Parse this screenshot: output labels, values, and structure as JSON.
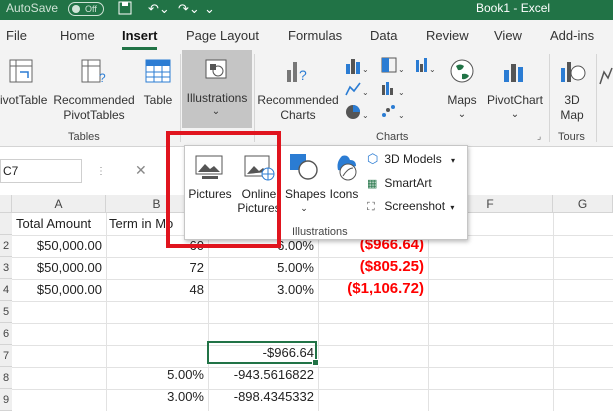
{
  "titlebar": {
    "autosave_label": "AutoSave",
    "autosave_state": "Off",
    "document_title": "Book1  -  Excel",
    "accent": "#217346"
  },
  "tabs": [
    "File",
    "Home",
    "Insert",
    "Page Layout",
    "Formulas",
    "Data",
    "Review",
    "View",
    "Add-ins"
  ],
  "active_tab": "Insert",
  "ribbon": {
    "tables_group": {
      "label": "Tables",
      "pivottable": "ivotTable",
      "recommended_pivot_1": "Recommended",
      "recommended_pivot_2": "PivotTables",
      "table": "Table"
    },
    "illustrations": {
      "label": "Illustrations",
      "chevron": "⌄"
    },
    "charts_group": {
      "label": "Charts",
      "recommended_1": "Recommended",
      "recommended_2": "Charts",
      "maps": "Maps",
      "pivotchart": "PivotChart"
    },
    "tours_group": {
      "label": "Tours",
      "map3d_1": "3D",
      "map3d_2": "Map"
    }
  },
  "formula_bar": {
    "name_box": "C7",
    "cancel": "✕"
  },
  "dropdown": {
    "pictures": "Pictures",
    "online_1": "Online",
    "online_2": "Pictures",
    "shapes": "Shapes",
    "icons": "Icons",
    "models_3d": "3D Models",
    "smartart": "SmartArt",
    "screenshot": "Screenshot",
    "group_label": "Illustrations"
  },
  "grid": {
    "columns": [
      "A",
      "B",
      "F",
      "G"
    ],
    "row_numbers": [
      "2",
      "3",
      "4",
      "5",
      "6",
      "7",
      "8",
      "9"
    ],
    "header_cells": {
      "a": "Total Amount",
      "b": "Term in Mo"
    },
    "rows": [
      {
        "a": "$50,000.00",
        "b": "60",
        "c": "6.00%",
        "d": "($966.64)"
      },
      {
        "a": "$50,000.00",
        "b": "72",
        "c": "5.00%",
        "d": "($805.25)"
      },
      {
        "a": "$50,000.00",
        "b": "48",
        "c": "3.00%",
        "d": "($1,106.72)"
      }
    ],
    "c7": "-$966.64",
    "row8": {
      "b": "5.00%",
      "c": "-943.5616822"
    },
    "row9": {
      "b": "3.00%",
      "c": "-898.4345332"
    },
    "negative_color": "#ff0000"
  },
  "highlight_color": "#e0141e"
}
